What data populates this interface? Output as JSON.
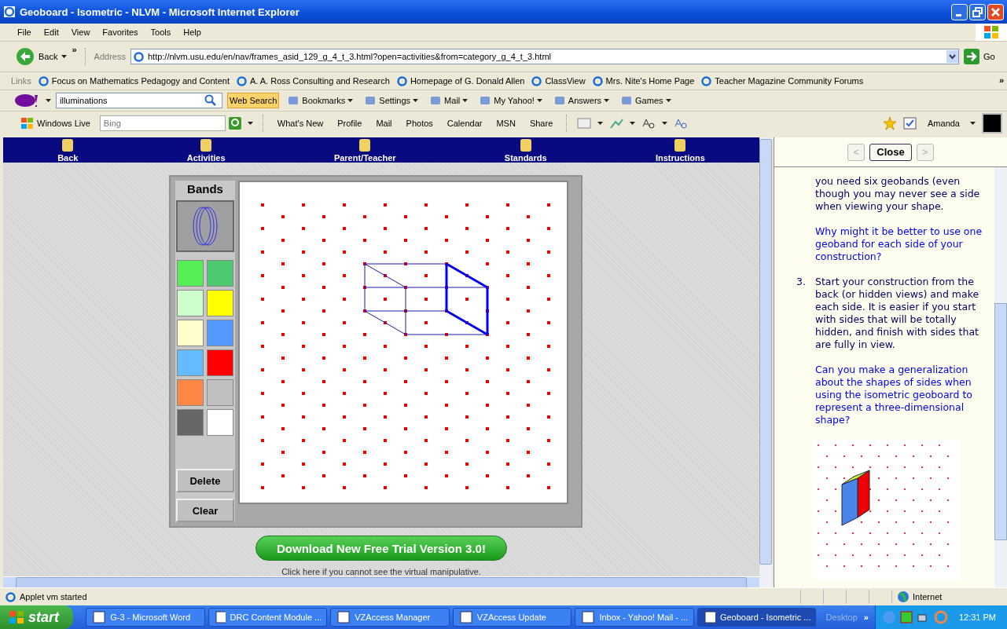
{
  "window": {
    "title": "Geoboard - Isometric - NLVM - Microsoft Internet Explorer"
  },
  "menu": [
    "File",
    "Edit",
    "View",
    "Favorites",
    "Tools",
    "Help"
  ],
  "nav": {
    "back": "Back",
    "more": "»",
    "address_label": "Address",
    "url": "http://nlvm.usu.edu/en/nav/frames_asid_129_g_4_t_3.html?open=activities&from=category_g_4_t_3.html",
    "go": "Go"
  },
  "links": {
    "label": "Links",
    "items": [
      "Focus on Mathematics Pedagogy and Content",
      "A. A. Ross Consulting and Research",
      "Homepage of G. Donald Allen",
      "ClassView",
      "Mrs. Nite's Home Page",
      "Teacher Magazine Community Forums"
    ],
    "more": "»"
  },
  "yahoo": {
    "search_value": "illuminations",
    "web_search": "Web Search",
    "items": [
      "Bookmarks",
      "Settings",
      "Mail",
      "My Yahoo!",
      "Answers",
      "Games"
    ]
  },
  "live": {
    "label": "Windows Live",
    "placeholder": "Bing",
    "items": [
      "What's New",
      "Profile",
      "Mail",
      "Photos",
      "Calendar",
      "MSN",
      "Share"
    ],
    "user": "Amanda"
  },
  "nlvm_nav": [
    "Back",
    "Activities",
    "Parent/Teacher",
    "Standards",
    "Instructions"
  ],
  "geoboard": {
    "bands_title": "Bands",
    "swatches": [
      {
        "color": "#55ee55"
      },
      {
        "color": "#4cc870"
      },
      {
        "color": "#ccffcc"
      },
      {
        "color": "#ffff00"
      },
      {
        "color": "#ffffcc"
      },
      {
        "color": "#5599ff"
      },
      {
        "color": "#66bbff"
      },
      {
        "color": "#ff0000"
      },
      {
        "color": "#ff8844"
      },
      {
        "color": "#c0c0c0"
      },
      {
        "color": "#666666"
      },
      {
        "color": "#ffffff"
      }
    ],
    "buttons": [
      "Delete",
      "Clear"
    ]
  },
  "download": {
    "label": "Download New Free Trial Version 3.0!",
    "help_link": "Click here if you cannot see the virtual manipulative."
  },
  "instructions": {
    "prev": "<",
    "close": "Close",
    "next": ">",
    "blocks": [
      {
        "kind": "text",
        "text": "you need six geobands (even though you may never see a side when viewing your shape."
      },
      {
        "kind": "question",
        "text": "Why might it be better to use one geoband for each side of your construction?"
      },
      {
        "kind": "step",
        "number": "3.",
        "text": "Start your construction from the back (or hidden views) and make each side. It is easier if you start with sides that will be totally hidden, and finish with sides that are fully in view."
      },
      {
        "kind": "question",
        "text": "Can you make a generalization about the shapes of sides when using the isometric geoboard to represent a three-dimensional shape?"
      }
    ]
  },
  "status": {
    "text": "Applet vm started",
    "zone": "Internet"
  },
  "taskbar": {
    "start": "start",
    "tasks": [
      {
        "label": "G-3 - Microsoft Word",
        "selected": false
      },
      {
        "label": "DRC Content Module ...",
        "selected": false
      },
      {
        "label": "VZAccess Manager",
        "selected": false
      },
      {
        "label": "VZAccess Update",
        "selected": false
      },
      {
        "label": "Inbox - Yahoo! Mail - ...",
        "selected": false
      },
      {
        "label": "Geoboard - Isometric ...",
        "selected": true
      }
    ],
    "desktop": "Desktop",
    "more": "»",
    "clock": "12:31 PM"
  }
}
